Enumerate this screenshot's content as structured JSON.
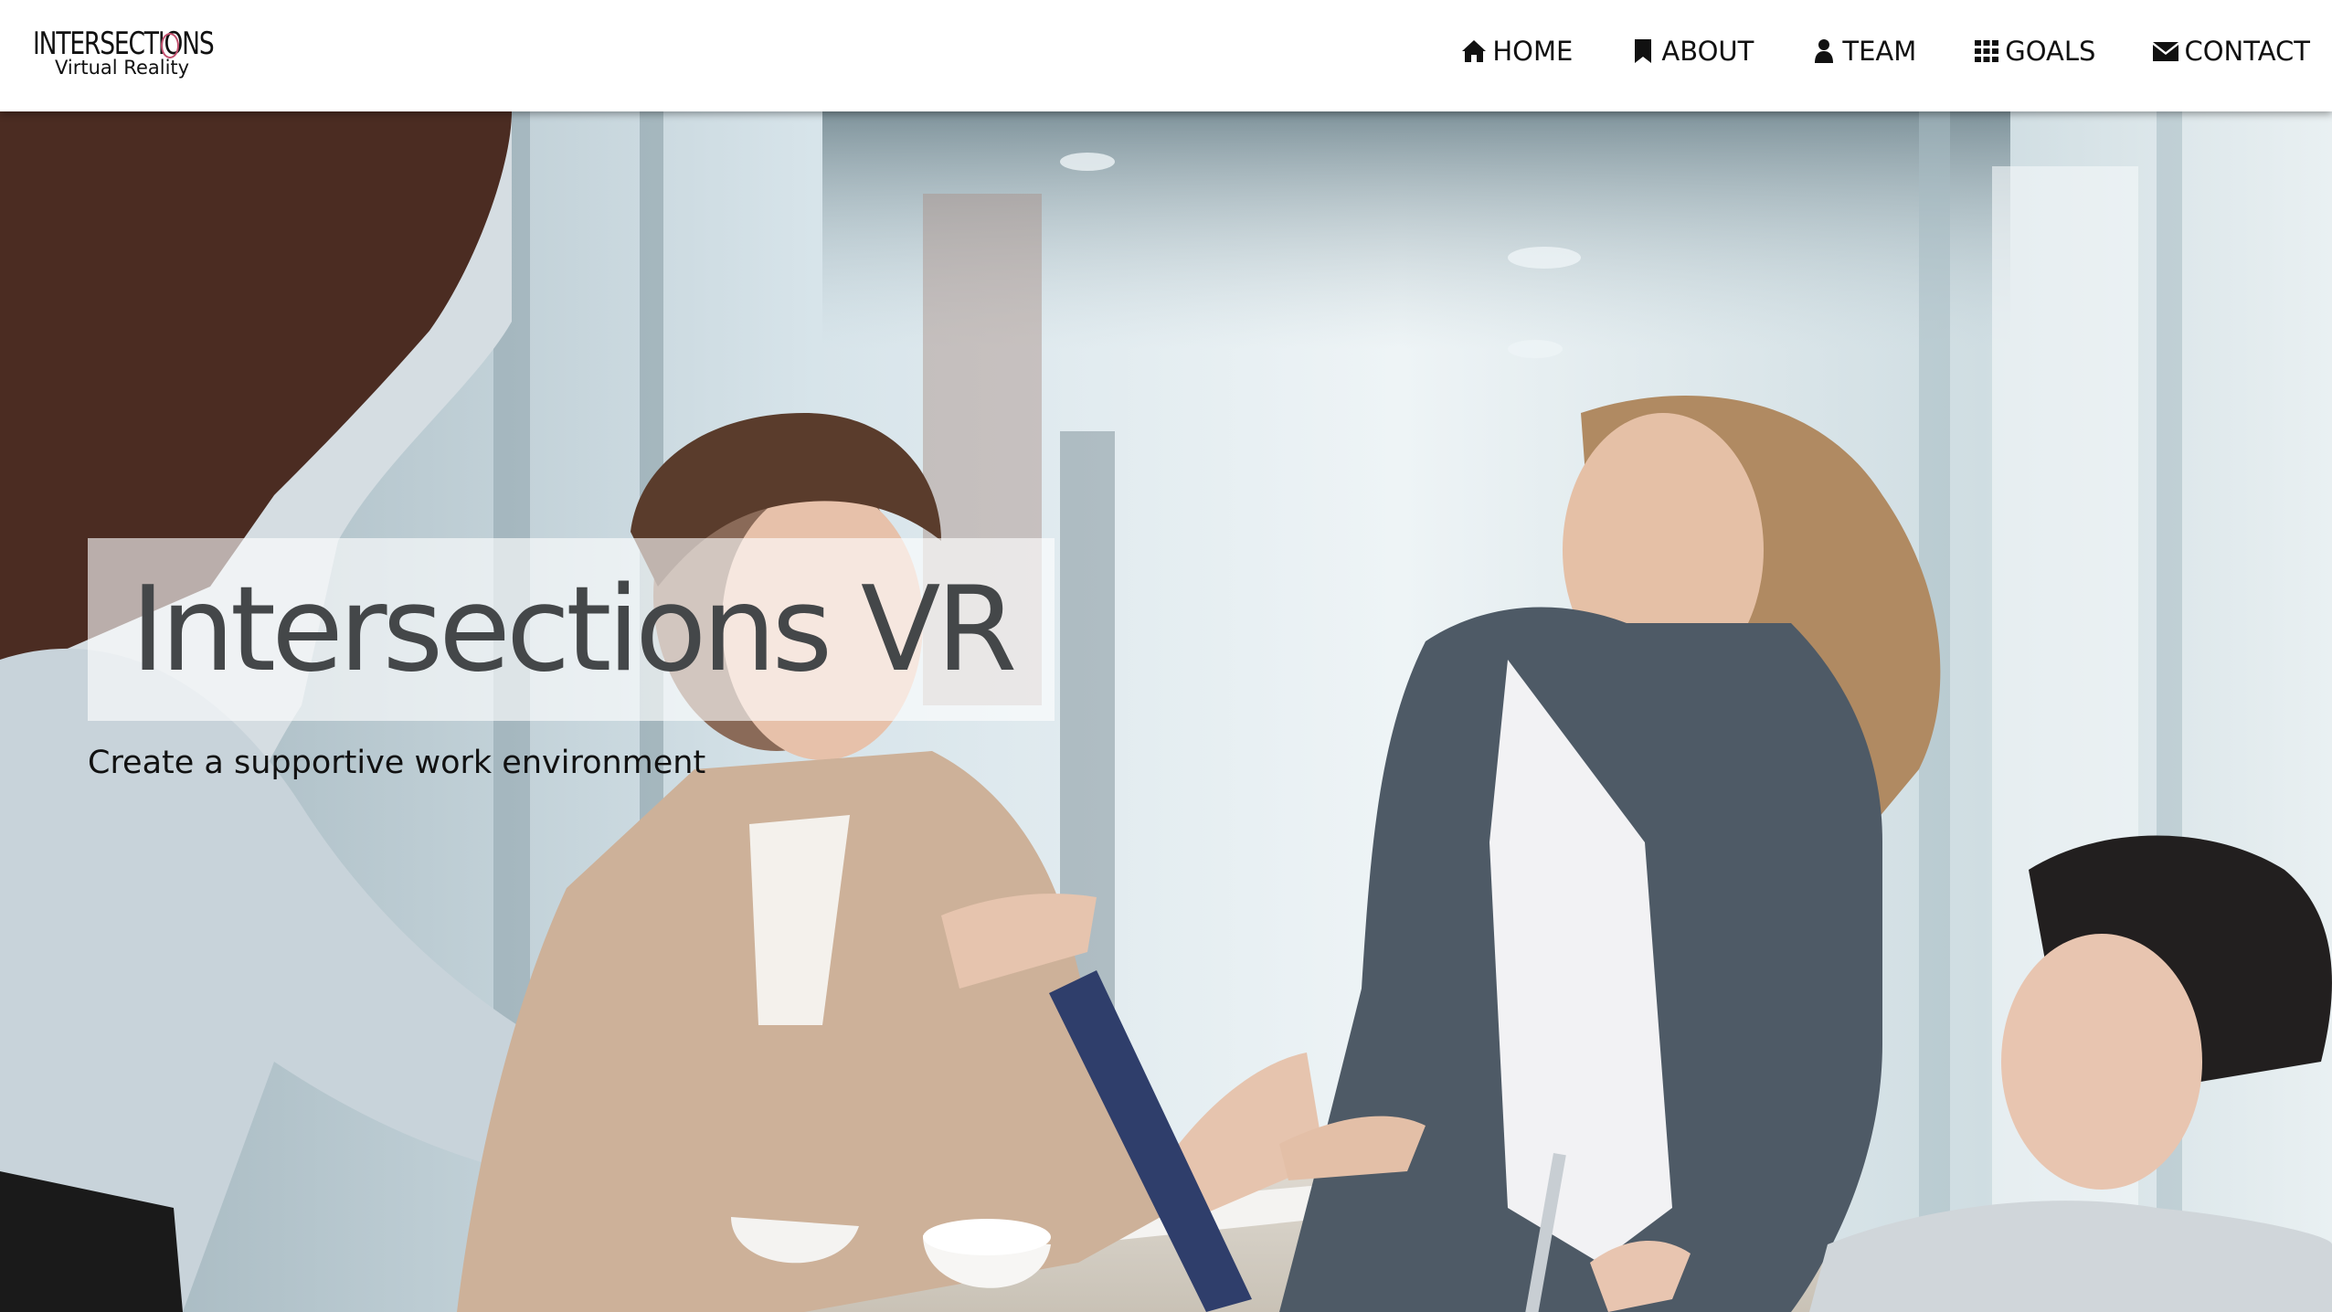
{
  "brand": {
    "logo_top": "INTERSECTIONS",
    "logo_bottom": "Virtual Reality",
    "accent_color": "#c2506e"
  },
  "nav": {
    "items": [
      {
        "label": "HOME",
        "icon": "home-icon"
      },
      {
        "label": "ABOUT",
        "icon": "bookmark-icon"
      },
      {
        "label": "TEAM",
        "icon": "user-icon"
      },
      {
        "label": "GOALS",
        "icon": "grid-icon"
      },
      {
        "label": "CONTACT",
        "icon": "envelope-icon"
      }
    ]
  },
  "hero": {
    "title": "Intersections VR",
    "subtitle": "Create a supportive work environment",
    "image": "office-meeting-photo"
  }
}
